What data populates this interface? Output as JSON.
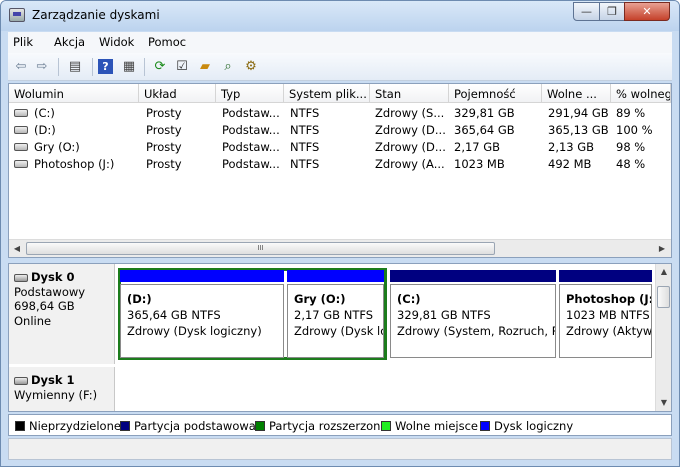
{
  "window": {
    "title": "Zarządzanie dyskami",
    "min_glyph": "—",
    "max_glyph": "❐",
    "close_glyph": "✕"
  },
  "menu": [
    "Plik",
    "Akcja",
    "Widok",
    "Pomoc"
  ],
  "toolbar": {
    "icons": [
      "back-arrow-icon",
      "forward-arrow-icon",
      "show-hide-console-icon",
      "help-icon",
      "properties-icon",
      "refresh-icon",
      "disk-properties-icon",
      "open-folder-icon",
      "search-icon",
      "settings-icon"
    ]
  },
  "volumes": {
    "columns": [
      "Wolumin",
      "Układ",
      "Typ",
      "System plik...",
      "Stan",
      "Pojemność",
      "Wolne ...",
      "% wolnego"
    ],
    "rows": [
      {
        "name": "(C:)",
        "layout": "Prosty",
        "type": "Podstaw...",
        "fs": "NTFS",
        "status": "Zdrowy (S...",
        "capacity": "329,81 GB",
        "free": "291,94 GB",
        "pct": "89 %"
      },
      {
        "name": "(D:)",
        "layout": "Prosty",
        "type": "Podstaw...",
        "fs": "NTFS",
        "status": "Zdrowy (D...",
        "capacity": "365,64 GB",
        "free": "365,13 GB",
        "pct": "100 %"
      },
      {
        "name": "Gry (O:)",
        "layout": "Prosty",
        "type": "Podstaw...",
        "fs": "NTFS",
        "status": "Zdrowy (D...",
        "capacity": "2,17 GB",
        "free": "2,13 GB",
        "pct": "98 %"
      },
      {
        "name": "Photoshop (J:)",
        "layout": "Prosty",
        "type": "Podstaw...",
        "fs": "NTFS",
        "status": "Zdrowy (A...",
        "capacity": "1023 MB",
        "free": "492 MB",
        "pct": "48 %"
      }
    ],
    "scroll_grip": "III"
  },
  "disks": [
    {
      "name": "Dysk 0",
      "type": "Podstawowy",
      "size": "698,64 GB",
      "state": "Online",
      "partitions": [
        {
          "name": "(D:)",
          "size": "365,64 GB NTFS",
          "status": "Zdrowy (Dysk logiczny)"
        },
        {
          "name": "Gry  (O:)",
          "size": "2,17 GB NTFS",
          "status": "Zdrowy (Dysk lo"
        },
        {
          "name": "(C:)",
          "size": "329,81 GB NTFS",
          "status": "Zdrowy (System, Rozruch, Pli"
        },
        {
          "name": "Photoshop  (J:",
          "size": "1023 MB NTFS",
          "status": "Zdrowy (Aktyw"
        }
      ]
    },
    {
      "name": "Dysk 1",
      "type": "Wymienny (F:)"
    }
  ],
  "legend": [
    {
      "label": "Nieprzydzielone",
      "color": "#000000"
    },
    {
      "label": "Partycja podstawowa",
      "color": "#000080"
    },
    {
      "label": "Partycja rozszerzona",
      "color": "#008000"
    },
    {
      "label": "Wolne miejsce",
      "color": "#22ee22"
    },
    {
      "label": "Dysk logiczny",
      "color": "#0000ff"
    }
  ]
}
